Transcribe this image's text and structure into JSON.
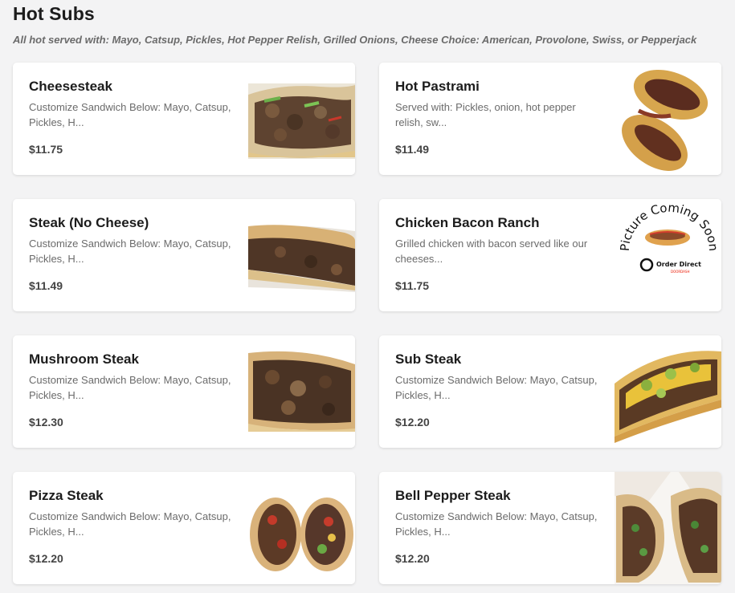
{
  "section": {
    "title": "Hot Subs",
    "subtitle": "All hot served with: Mayo, Catsup, Pickles, Hot Pepper Relish, Grilled Onions, Cheese Choice: American, Provolone, Swiss, or Pepperjack"
  },
  "items": [
    {
      "name": "Cheesesteak",
      "desc": "Customize Sandwich Below: Mayo, Catsup, Pickles, H...",
      "price": "$11.75",
      "photo": "cheesesteak-photo"
    },
    {
      "name": "Hot Pastrami",
      "desc": "Served with: Pickles, onion, hot pepper relish, sw...",
      "price": "$11.49",
      "photo": "pastrami-photo"
    },
    {
      "name": "Steak (No Cheese)",
      "desc": "Customize Sandwich Below: Mayo, Catsup, Pickles, H...",
      "price": "$11.49",
      "photo": "steak-photo"
    },
    {
      "name": "Chicken Bacon Ranch",
      "desc": "Grilled chicken with bacon served like our cheeses...",
      "price": "$11.75",
      "photo": "picture-coming-soon-placeholder",
      "placeholder_text": "Picture Coming Soon",
      "placeholder_brand": "Order Direct",
      "placeholder_sub": "DOORDASH"
    },
    {
      "name": "Mushroom Steak",
      "desc": "Customize Sandwich Below: Mayo, Catsup, Pickles, H...",
      "price": "$12.30",
      "photo": "mushroom-steak-photo"
    },
    {
      "name": "Sub Steak",
      "desc": "Customize Sandwich Below: Mayo, Catsup, Pickles, H...",
      "price": "$12.20",
      "photo": "sub-steak-photo"
    },
    {
      "name": "Pizza Steak",
      "desc": "Customize Sandwich Below: Mayo, Catsup, Pickles, H...",
      "price": "$12.20",
      "photo": "pizza-steak-photo"
    },
    {
      "name": "Bell Pepper Steak",
      "desc": "Customize Sandwich Below: Mayo, Catsup, Pickles, H...",
      "price": "$12.20",
      "photo": "bell-pepper-steak-photo"
    }
  ],
  "colors": {
    "background": "#f3f3f4",
    "card": "#ffffff",
    "text": "#1c1c1c",
    "muted": "#6b6b6b",
    "brand": "#eb1700"
  }
}
